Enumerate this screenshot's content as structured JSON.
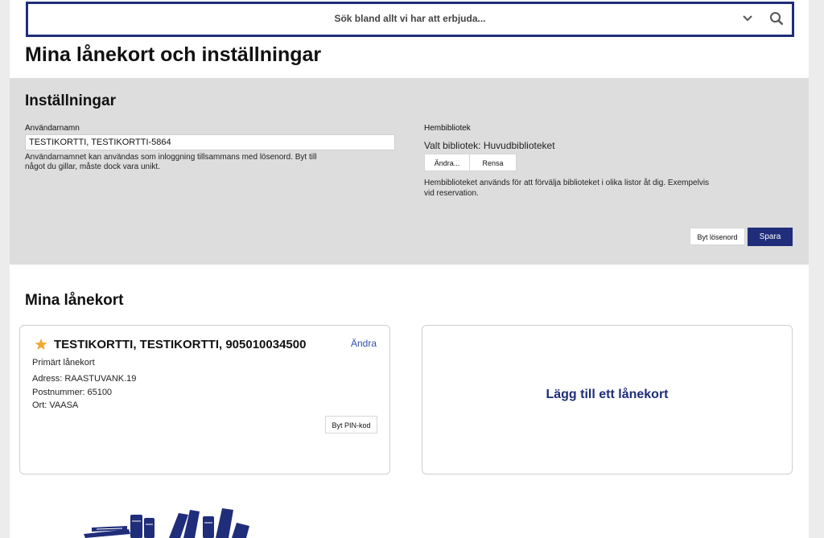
{
  "search": {
    "placeholder": "Sök bland allt vi har att erbjuda..."
  },
  "page_title": "Mina lånekort och inställningar",
  "settings": {
    "heading": "Inställningar",
    "username_label": "Användarnamn",
    "username_value": "TESTIKORTTI, TESTIKORTTI-5864",
    "username_help_1": "Användarnamnet kan användas som inloggning tillsammans med lösenord. Byt till",
    "username_help_2": "något du gillar, måste dock vara unikt.",
    "home_library_label": "Hembibliotek",
    "selected_library": "Valt bibliotek: Huvudbiblioteket",
    "change_button": "Ändra...",
    "clear_button": "Rensa",
    "home_library_help_1": "Hembiblioteket används för att förvälja biblioteket i olika listor åt dig. Exempelvis",
    "home_library_help_2": "vid reservation.",
    "change_password_button": "Byt lösenord",
    "save_button": "Spara"
  },
  "cards": {
    "heading": "Mina lånekort",
    "primary_card": {
      "name": "TESTIKORTTI, TESTIKORTTI, 905010034500",
      "edit_link": "Ändra",
      "type": "Primärt lånekort",
      "address": "Adress: RAASTUVANK.19",
      "postal_code": "Postnummer: 65100",
      "city": "Ort: VAASA",
      "change_pin_button": "Byt PIN-kod"
    },
    "add_card_label": "Lägg till ett lånekort"
  },
  "colors": {
    "brand": "#1f2d7a",
    "link": "#2f4db0",
    "star": "#f0a830",
    "panel": "#dddddd"
  },
  "icons": [
    "chevron-down-icon",
    "search-icon",
    "star-icon",
    "books-logo"
  ]
}
